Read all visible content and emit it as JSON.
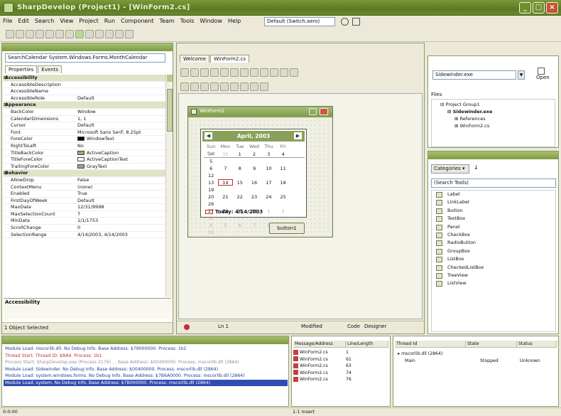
{
  "window": {
    "title": "SharpDevelop (Project1) - [WinForm2.cs]"
  },
  "menu": [
    "File",
    "Edit",
    "Search",
    "View",
    "Project",
    "Run",
    "Component",
    "Team",
    "Tools",
    "Window",
    "Help"
  ],
  "toolbar": {
    "config": "Default (Switch.aero)"
  },
  "properties": {
    "object": "SearchCalendar  System.Windows.Forms.MonthCalendar",
    "tabs": [
      "Properties",
      "Events"
    ],
    "rows": [
      {
        "k": "Accessibility",
        "v": "",
        "cat": true
      },
      {
        "k": "AccessibleDescription",
        "v": ""
      },
      {
        "k": "AccessibleName",
        "v": ""
      },
      {
        "k": "AccessibleRole",
        "v": "Default"
      },
      {
        "k": "Appearance",
        "v": "",
        "cat": true
      },
      {
        "k": "BackColor",
        "v": "Window"
      },
      {
        "k": "CalendarDimensions",
        "v": "1, 1"
      },
      {
        "k": "Cursor",
        "v": "Default"
      },
      {
        "k": "Font",
        "v": "Microsoft Sans Serif, 8.25pt"
      },
      {
        "k": "ForeColor",
        "v": "WindowText",
        "swatch": "#000000"
      },
      {
        "k": "RightToLeft",
        "v": "No"
      },
      {
        "k": "TitleBackColor",
        "v": "ActiveCaption",
        "swatch": "#9aaa70"
      },
      {
        "k": "TitleForeColor",
        "v": "ActiveCaptionText",
        "swatch": "#ffffff"
      },
      {
        "k": "TrailingForeColor",
        "v": "GrayText",
        "swatch": "#a0a090"
      },
      {
        "k": "Behavior",
        "v": "",
        "cat": true
      },
      {
        "k": "AllowDrop",
        "v": "False"
      },
      {
        "k": "ContextMenu",
        "v": "(none)"
      },
      {
        "k": "Enabled",
        "v": "True"
      },
      {
        "k": "FirstDayOfWeek",
        "v": "Default"
      },
      {
        "k": "MaxDate",
        "v": "12/31/9998"
      },
      {
        "k": "MaxSelectionCount",
        "v": "7"
      },
      {
        "k": "MinDate",
        "v": "1/1/1753"
      },
      {
        "k": "ScrollChange",
        "v": "0"
      },
      {
        "k": "SelectionRange",
        "v": "4/14/2003, 4/14/2003"
      }
    ],
    "desc_title": "Accessibility",
    "footer": "1 Object Selected"
  },
  "doc": {
    "tabs": [
      "Welcome",
      "WinForm2.cs"
    ],
    "form_title": "WinForm2",
    "calendar": {
      "month": "April, 2003",
      "weekdays": [
        "Sun",
        "Mon",
        "Tue",
        "Wed",
        "Thu",
        "Fri",
        "Sat"
      ],
      "weeks": [
        [
          "30",
          "31",
          "1",
          "2",
          "3",
          "4",
          "5"
        ],
        [
          "6",
          "7",
          "8",
          "9",
          "10",
          "11",
          "12"
        ],
        [
          "13",
          "14",
          "15",
          "16",
          "17",
          "18",
          "19"
        ],
        [
          "20",
          "21",
          "22",
          "23",
          "24",
          "25",
          "26"
        ],
        [
          "27",
          "28",
          "29",
          "30",
          "1",
          "2",
          "3"
        ],
        [
          "4",
          "5",
          "6",
          "7",
          "8",
          "9",
          "10"
        ]
      ],
      "today": "Today: 4/14/2003"
    },
    "button": "button1",
    "status": {
      "line": "Ln 1",
      "mode": "Modified",
      "code": "Code",
      "design": "Designer"
    }
  },
  "project": {
    "combo": "Sidewinder.exe",
    "open_label": "Open",
    "files_label": "Files",
    "tree": [
      "Project Group1",
      "Sidewinder.exe",
      "References",
      "WinForm2.cs"
    ]
  },
  "tools": {
    "categories": "Categories",
    "search": "(Search Tools)",
    "items": [
      "Label",
      "LinkLabel",
      "Button",
      "TextBox",
      "Panel",
      "CheckBox",
      "RadioButton",
      "GroupBox",
      "ListBox",
      "CheckedListBox",
      "TreeView",
      "ListView"
    ]
  },
  "output": {
    "lines": [
      "Module Load: mscorlib.dll. No Debug Info. Base Address: $79000000. Process: 1b1",
      "Thread Start: Thread ID: $BA4. Process: 1b1",
      "Process Start: SharpDevelop.exe (Process 2176) ... Base Address: $00400000. Process: mscorlib.dll (2864)",
      "Module Load: Sidewinder. No Debug Info. Base Address: $00400000. Process: mscorlib.dll (2864)",
      "Module Load: system.windows.forms. No Debug Info. Base Address: $7B6A0000. Process: mscorlib.dll (2864)",
      "Module Load: system. No Debug Info. Base Address: $7B000000. Process: mscorlib.dll (2864)"
    ]
  },
  "messages": {
    "cols": [
      "Message/Address",
      "Line/Length"
    ],
    "rows": [
      [
        "WinForm2.cs",
        "1"
      ],
      [
        "WinForm2.cs",
        "61"
      ],
      [
        "WinForm2.cs",
        "63"
      ],
      [
        "WinForm2.cs",
        "74"
      ],
      [
        "WinForm2.cs",
        "76"
      ]
    ]
  },
  "threads": {
    "cols": [
      "Thread Id",
      "State",
      "Status"
    ],
    "rows": [
      [
        "mscorlib.dll (2864)",
        "",
        ""
      ],
      [
        "Main",
        "Stopped",
        "Unknown"
      ]
    ]
  },
  "statusbar": {
    "left": "0:0:00",
    "mid": "1:1 Insert",
    "right": ""
  }
}
